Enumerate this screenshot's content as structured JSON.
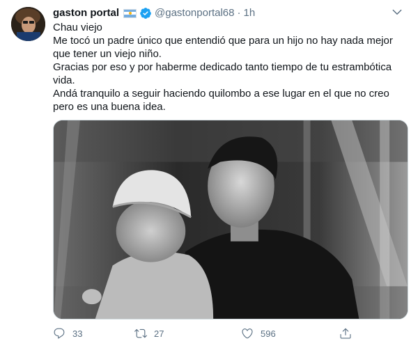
{
  "tweet": {
    "display_name": "gaston portal",
    "flag": "argentina-flag",
    "verified": true,
    "handle": "@gastonportal68",
    "separator": "·",
    "time": "1h",
    "text_lines": [
      "Chau viejo",
      "Me tocó un padre único que entendió que para un hijo no hay nada mejor que tener un viejo niño.",
      "Gracias por eso y por haberme dedicado tanto tiempo de tu estrambótica vida.",
      "Andá tranquilo a seguir haciendo quilombo a ese lugar en el que no creo pero es una buena idea."
    ],
    "media": {
      "kind": "black-and-white photo"
    },
    "actions": {
      "reply_count": "33",
      "retweet_count": "27",
      "like_count": "596"
    }
  },
  "colors": {
    "text": "#0f1419",
    "secondary": "#5b7083",
    "verified_blue": "#1da1f2",
    "border": "#cfd9de"
  },
  "icons": [
    "more-icon",
    "verified-icon",
    "reply-icon",
    "retweet-icon",
    "like-icon",
    "share-icon"
  ]
}
